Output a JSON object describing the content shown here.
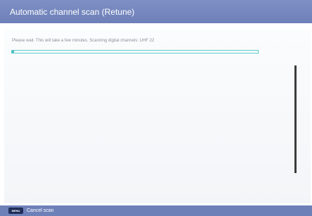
{
  "window": {
    "title": "Automatic channel scan (Retune)"
  },
  "scan": {
    "status_text": "Please wait. This will take a few minutes. Scanning digital channels: UHF 22",
    "progress": 0.01
  },
  "footer": {
    "menu_key_label": "MENU",
    "cancel_label": "Cancel scan"
  },
  "colors": {
    "title_bar": "#6e80b8",
    "progress_border": "#5dc9c9",
    "progress_fill": "#49b8bd",
    "scrollbar": "#3c3c3c",
    "status_text": "#8a8f98"
  }
}
